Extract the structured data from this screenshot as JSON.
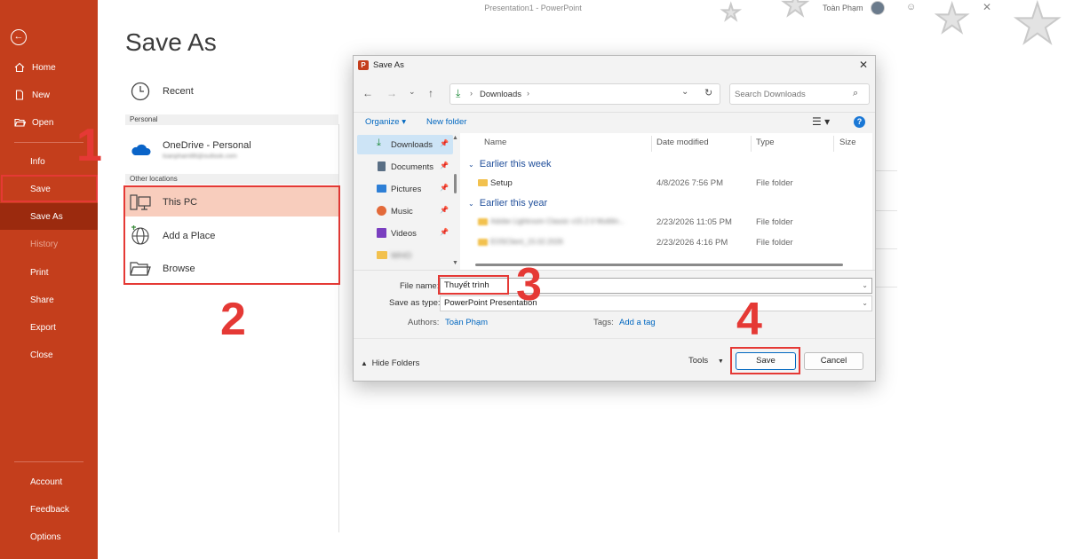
{
  "app": {
    "title": "Presentation1 - PowerPoint",
    "user": "Toàn Phạm"
  },
  "colors": {
    "rail": "#c43e1c",
    "rail_active": "#9b2a0e",
    "highlight": "#f8cdbd",
    "annotation": "#e53935",
    "accent": "#0067c0"
  },
  "rail": {
    "back_icon": "back-arrow-icon",
    "items": [
      {
        "label": "Home",
        "icon": "home-icon"
      },
      {
        "label": "New",
        "icon": "new-file-icon"
      },
      {
        "label": "Open",
        "icon": "folder-open-icon"
      },
      {
        "label": "Info"
      },
      {
        "label": "Save"
      },
      {
        "label": "Save As"
      },
      {
        "label": "History"
      },
      {
        "label": "Print"
      },
      {
        "label": "Share"
      },
      {
        "label": "Export"
      },
      {
        "label": "Close"
      }
    ],
    "bottom": [
      {
        "label": "Account"
      },
      {
        "label": "Feedback"
      },
      {
        "label": "Options"
      }
    ]
  },
  "backstage": {
    "title": "Save As",
    "recent": "Recent",
    "group_personal": "Personal",
    "onedrive": {
      "label": "OneDrive - Personal",
      "email": "toanpham86@outlook.com"
    },
    "group_other": "Other locations",
    "this_pc": "This PC",
    "add_place": "Add a Place",
    "browse": "Browse"
  },
  "dialog": {
    "title": "Save As",
    "address": "Downloads",
    "search_placeholder": "Search Downloads",
    "organize": "Organize",
    "new_folder": "New folder",
    "nav": [
      {
        "label": "Downloads",
        "icon": "download-icon"
      },
      {
        "label": "Documents",
        "icon": "documents-icon"
      },
      {
        "label": "Pictures",
        "icon": "pictures-icon"
      },
      {
        "label": "Music",
        "icon": "music-icon"
      },
      {
        "label": "Videos",
        "icon": "videos-icon"
      },
      {
        "label": "WHO",
        "icon": "folder-icon"
      }
    ],
    "columns": {
      "name": "Name",
      "date": "Date modified",
      "type": "Type",
      "size": "Size"
    },
    "groups": [
      {
        "label": "Earlier this week",
        "rows": [
          {
            "name": "Setup",
            "date": "4/8/2026 7:56 PM",
            "type": "File folder"
          }
        ]
      },
      {
        "label": "Earlier this year",
        "rows": [
          {
            "name": "Adobe Lightroom Classic v15.2.0 Multilin...",
            "date": "2/23/2026 11:05 PM",
            "type": "File folder"
          },
          {
            "name": "EOSClient_15.02.2026",
            "date": "2/23/2026 4:16 PM",
            "type": "File folder"
          }
        ]
      }
    ],
    "file_name_label": "File name:",
    "file_name": "Thuyết trình",
    "save_type_label": "Save as type:",
    "save_type": "PowerPoint Presentation",
    "authors_label": "Authors:",
    "authors": "Toàn Phạm",
    "tags_label": "Tags:",
    "tags": "Add a tag",
    "hide_folders": "Hide Folders",
    "tools": "Tools",
    "save": "Save",
    "cancel": "Cancel"
  },
  "steps": [
    "1",
    "2",
    "3",
    "4"
  ]
}
